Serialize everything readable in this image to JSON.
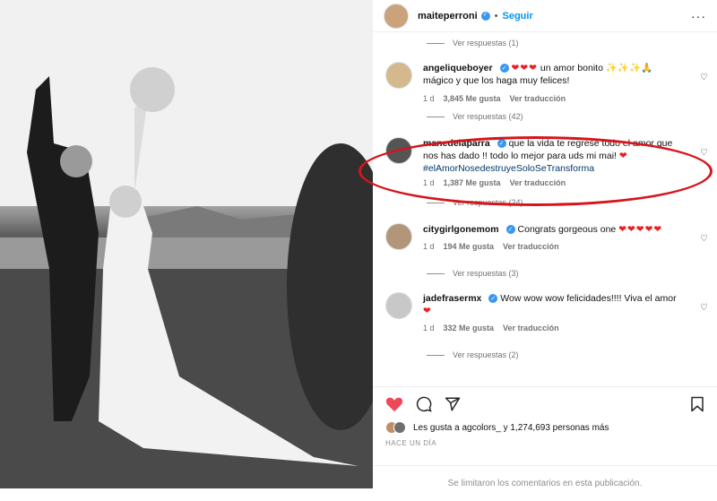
{
  "header": {
    "username": "maiteperroni",
    "follow_label": "Seguir",
    "more_label": "···"
  },
  "comments": [
    {
      "replies_label": "Ver respuestas (1)"
    },
    {
      "username": "angeliqueboyer",
      "text": "un amor bonito",
      "hearts": "❤❤❤",
      "emoji_end": "✨✨✨🙏",
      "text2": "mágico y que los haga muy felices!",
      "time": "1 d",
      "likes": "3,845 Me gusta",
      "reply_label": "Ver traducción",
      "replies_label": "Ver respuestas (42)"
    },
    {
      "username": "manedelaparra",
      "text": "que la vida te regrese todo el amor que nos has dado !! todo lo mejor para uds mi mai!",
      "hearts": "❤",
      "hashtag": "#elAmorNosedestruyeSoloSeTransforma",
      "time": "1 d",
      "likes": "1,387 Me gusta",
      "reply_label": "Ver traducción",
      "replies_label": "Ver respuestas (24)"
    },
    {
      "username": "citygirlgonemom",
      "text": "Congrats gorgeous one",
      "hearts": "❤❤❤❤❤",
      "time": "1 d",
      "likes": "194 Me gusta",
      "reply_label": "Ver traducción",
      "replies_label": "Ver respuestas (3)"
    },
    {
      "username": "jadefrasermx",
      "text": "Wow wow wow felicidades!!!! Viva el amor",
      "hearts": "❤",
      "time": "1 d",
      "likes": "332 Me gusta",
      "reply_label": "Ver traducción",
      "replies_label": "Ver respuestas (2)"
    }
  ],
  "actions": {
    "likes_text": "Les gusta a agcolors_ y 1,274,693 personas más",
    "time_ago": "HACE UN DÍA"
  },
  "footer": {
    "limited_text": "Se limitaron los comentarios en esta publicación."
  },
  "colors": {
    "accent": "#0095f6",
    "like_red": "#ed1c24",
    "highlight": "#d7131b"
  }
}
